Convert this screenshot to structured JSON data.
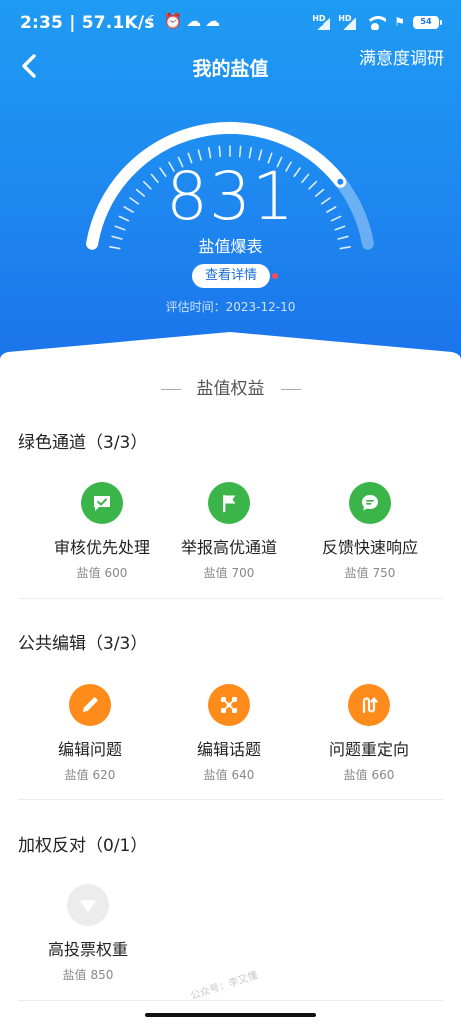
{
  "status_bar": {
    "time": "2:35",
    "speed": "57.1K/s",
    "battery": "54",
    "signal_1": "HD",
    "signal_2": "HD"
  },
  "header": {
    "title": "我的盐值",
    "survey": "满意度调研"
  },
  "score": {
    "value": "831",
    "level": "盐值爆表",
    "detail_button": "查看详情",
    "eval_time": "评估时间：2023-12-10"
  },
  "benefits": {
    "title": "盐值权益",
    "groups": [
      {
        "title": "绿色通道（3/3）",
        "items": [
          {
            "name": "审核优先处理",
            "req": "盐值 600",
            "icon": "chat-check-icon"
          },
          {
            "name": "举报高优通道",
            "req": "盐值 700",
            "icon": "flag-icon"
          },
          {
            "name": "反馈快速响应",
            "req": "盐值 750",
            "icon": "message-icon"
          }
        ]
      },
      {
        "title": "公共编辑（3/3）",
        "items": [
          {
            "name": "编辑问题",
            "req": "盐值 620",
            "icon": "pencil-icon"
          },
          {
            "name": "编辑话题",
            "req": "盐值 640",
            "icon": "nodes-icon"
          },
          {
            "name": "问题重定向",
            "req": "盐值 660",
            "icon": "redirect-icon"
          }
        ]
      },
      {
        "title": "加权反对（0/1）",
        "items": [
          {
            "name": "高投票权重",
            "req": "盐值 850",
            "icon": "downvote-icon"
          }
        ]
      }
    ]
  },
  "watermark": "公众号：李又懂",
  "colors": {
    "primary_blue": "#1e87f0",
    "green": "#3bb54a",
    "orange": "#ff8c1a",
    "locked_grey": "#ececec"
  }
}
